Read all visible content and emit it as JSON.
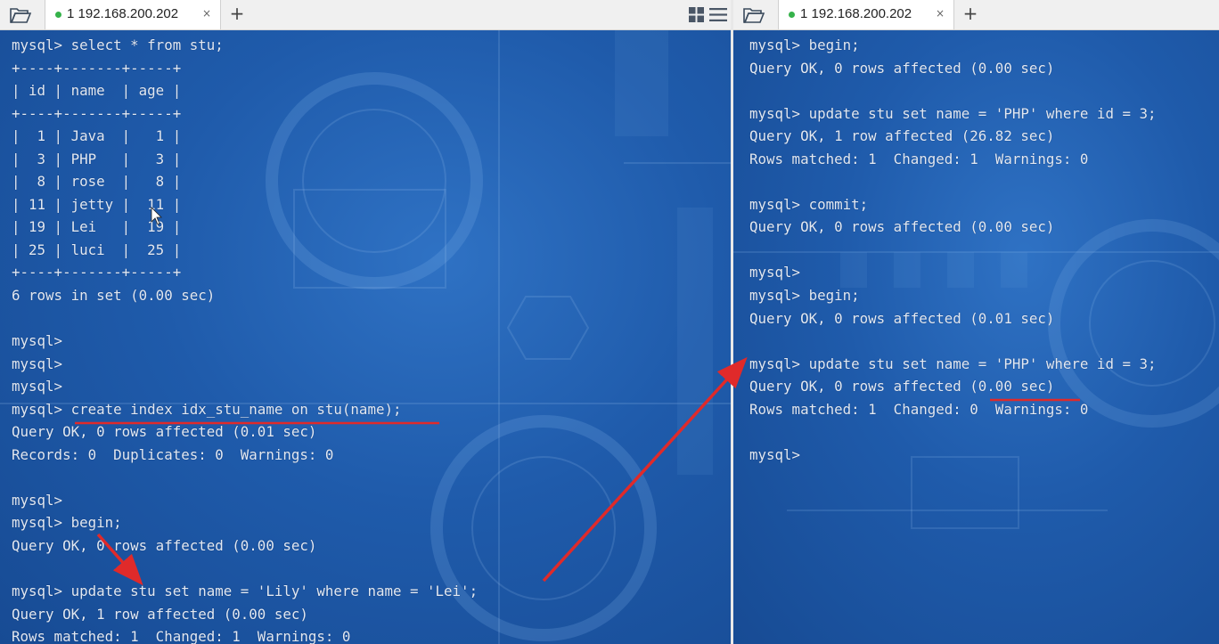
{
  "left_pane": {
    "tab": {
      "label": "1 192.168.200.202",
      "close": "×"
    },
    "add_tab": "+",
    "lines": [
      "mysql> select * from stu;",
      "+----+-------+-----+",
      "| id | name  | age |",
      "+----+-------+-----+",
      "|  1 | Java  |   1 |",
      "|  3 | PHP   |   3 |",
      "|  8 | rose  |   8 |",
      "| 11 | jetty |  11 |",
      "| 19 | Lei   |  19 |",
      "| 25 | luci  |  25 |",
      "+----+-------+-----+",
      "6 rows in set (0.00 sec)",
      "",
      "mysql>",
      "mysql>",
      "mysql>",
      "mysql> create index idx_stu_name on stu(name);",
      "Query OK, 0 rows affected (0.01 sec)",
      "Records: 0  Duplicates: 0  Warnings: 0",
      "",
      "mysql>",
      "mysql> begin;",
      "Query OK, 0 rows affected (0.00 sec)",
      "",
      "mysql> update stu set name = 'Lily' where name = 'Lei';",
      "Query OK, 1 row affected (0.00 sec)",
      "Rows matched: 1  Changed: 1  Warnings: 0"
    ]
  },
  "right_pane": {
    "tab": {
      "label": "1 192.168.200.202",
      "close": "×"
    },
    "add_tab": "+",
    "lines": [
      "mysql> begin;",
      "Query OK, 0 rows affected (0.00 sec)",
      "",
      "mysql> update stu set name = 'PHP' where id = 3;",
      "Query OK, 1 row affected (26.82 sec)",
      "Rows matched: 1  Changed: 1  Warnings: 0",
      "",
      "mysql> commit;",
      "Query OK, 0 rows affected (0.00 sec)",
      "",
      "mysql>",
      "mysql> begin;",
      "Query OK, 0 rows affected (0.01 sec)",
      "",
      "mysql> update stu set name = 'PHP' where id = 3;",
      "Query OK, 0 rows affected (0.00 sec)",
      "Rows matched: 1  Changed: 0  Warnings: 0",
      "",
      "mysql>"
    ]
  },
  "icons": {
    "folder": "folder-open-icon",
    "grid": "grid-view-icon",
    "menu": "hamburger-menu-icon",
    "status": "connection-status-dot-icon",
    "cursor": "mouse-pointer-icon"
  },
  "colors": {
    "annotation": "#e02a2a",
    "terminal_bg": "#1f5bab",
    "terminal_text": "#e2e9f3",
    "status_dot": "#35b24a"
  }
}
